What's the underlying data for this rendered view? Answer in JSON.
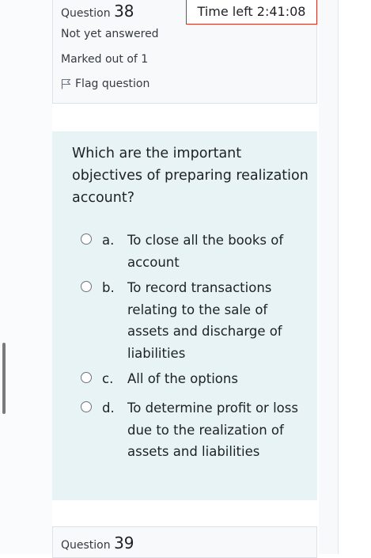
{
  "question_info": {
    "label": "Question",
    "number": "38",
    "status": "Not yet answered",
    "marks": "Marked out of 1",
    "flag_label": "Flag question"
  },
  "timer": {
    "text": "Time left 2:41:08"
  },
  "question": {
    "text": "Which are the important objectives of preparing realization account?",
    "answers": [
      {
        "letter": "a.",
        "text": "To close all the books of account"
      },
      {
        "letter": "b.",
        "text": "To record transactions relating to the sale of assets and discharge of liabilities"
      },
      {
        "letter": "c.",
        "text": "All of the options"
      },
      {
        "letter": "d.",
        "text": "To determine profit or loss due to the realization of assets and liabilities"
      }
    ]
  },
  "next_question": {
    "label": "Question",
    "number": "39"
  },
  "colors": {
    "question_bg": "#e7f3f5",
    "timer_border": "#ca3120"
  }
}
